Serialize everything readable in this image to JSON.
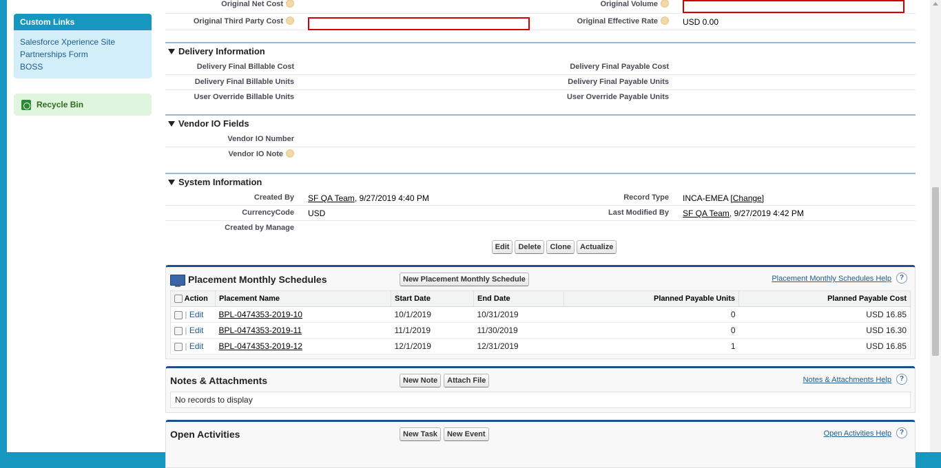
{
  "sidebar": {
    "custom_links_title": "Custom Links",
    "links": [
      "Salesforce Xperience Site",
      "Partnerships Form",
      "BOSS"
    ],
    "recycle_bin": "Recycle Bin"
  },
  "top_fields": {
    "original_net_cost": "Original Net Cost",
    "original_volume": "Original Volume",
    "original_third_party_cost": "Original Third Party Cost",
    "original_effective_rate": "Original Effective Rate",
    "original_effective_rate_value": "USD 0.00"
  },
  "delivery": {
    "title": "Delivery Information",
    "rows": [
      {
        "left": "Delivery Final Billable Cost",
        "right": "Delivery Final Payable Cost"
      },
      {
        "left": "Delivery Final Billable Units",
        "right": "Delivery Final Payable Units"
      },
      {
        "left": "User Override Billable Units",
        "right": "User Override Payable Units"
      }
    ]
  },
  "vendor": {
    "title": "Vendor IO Fields",
    "io_number": "Vendor IO Number",
    "io_note": "Vendor IO Note"
  },
  "system": {
    "title": "System Information",
    "created_by_label": "Created By",
    "created_by_user": "SF QA Team",
    "created_by_date": ", 9/27/2019 4:40 PM",
    "record_type_label": "Record Type",
    "record_type_value": "INCA-EMEA ",
    "change_link": "[Change]",
    "currency_label": "CurrencyCode",
    "currency_value": "USD",
    "last_modified_label": "Last Modified By",
    "last_modified_user": "SF QA Team",
    "last_modified_date": ", 9/27/2019 4:42 PM",
    "created_by_manage": "Created by Manage"
  },
  "buttons": {
    "edit": "Edit",
    "delete": "Delete",
    "clone": "Clone",
    "actualize": "Actualize"
  },
  "schedules": {
    "title": "Placement Monthly Schedules",
    "new_button": "New Placement Monthly Schedule",
    "help": "Placement Monthly Schedules Help",
    "columns": [
      "Action",
      "Placement Name",
      "Start Date",
      "End Date",
      "Planned Payable Units",
      "Planned Payable Cost"
    ],
    "rows": [
      {
        "action": "Edit",
        "name": "BPL-0474353-2019-10",
        "start": "10/1/2019",
        "end": "10/31/2019",
        "units": "0",
        "cost": "USD 16.85"
      },
      {
        "action": "Edit",
        "name": "BPL-0474353-2019-11",
        "start": "11/1/2019",
        "end": "11/30/2019",
        "units": "0",
        "cost": "USD 16.30"
      },
      {
        "action": "Edit",
        "name": "BPL-0474353-2019-12",
        "start": "12/1/2019",
        "end": "12/31/2019",
        "units": "1",
        "cost": "USD 16.85"
      }
    ]
  },
  "notes": {
    "title": "Notes & Attachments",
    "new_note": "New Note",
    "attach_file": "Attach File",
    "help": "Notes & Attachments Help",
    "empty": "No records to display"
  },
  "activities": {
    "title": "Open Activities",
    "new_task": "New Task",
    "new_event": "New Event",
    "help": "Open Activities Help"
  },
  "help_glyph": "?",
  "colors": {
    "accent": "#1797c0",
    "section_rule": "#98b6d8",
    "related_list_border": "#1f4f8a",
    "required_border": "#d30000"
  }
}
